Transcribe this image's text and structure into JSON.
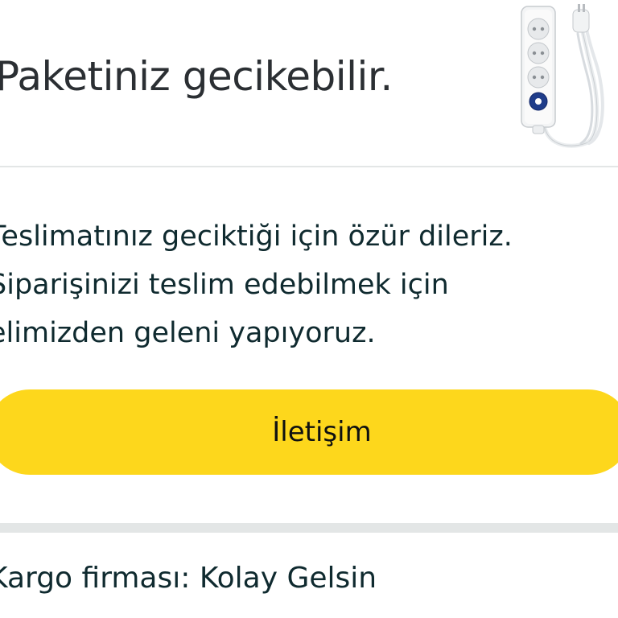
{
  "header": {
    "title": "Paketiniz gecikebilir.",
    "product_image": "power-strip-extension-cord"
  },
  "message": {
    "line1": "Teslimatınız geciktiği için özür dileriz.",
    "line2": "Siparişinizi teslim edebilmek için",
    "line3": "elimizden geleni yapıyoruz."
  },
  "contact_button": {
    "label": "İletişim",
    "color": "#fdd71c"
  },
  "carrier": {
    "text": "Kargo firması: Kolay Gelsin"
  }
}
